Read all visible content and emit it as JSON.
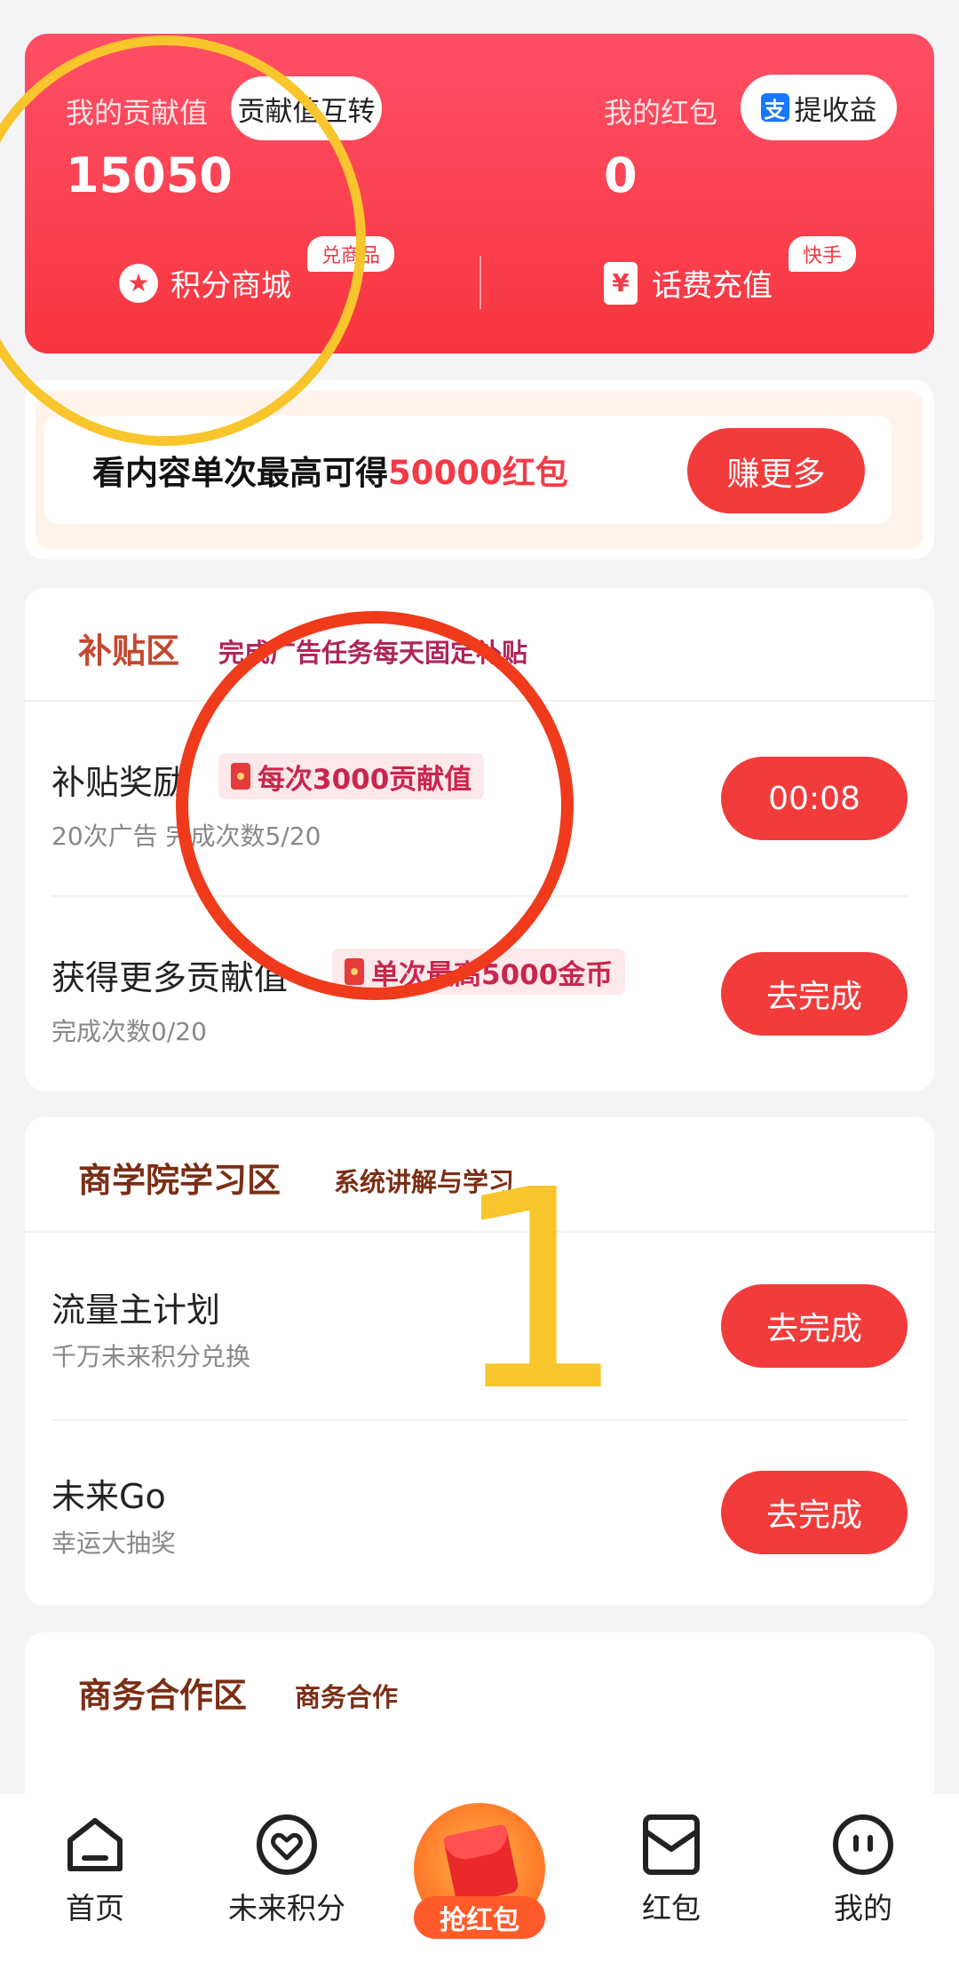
{
  "top_card": {
    "contribution_label": "我的贡献值",
    "contribution_convert_btn": "贡献值互转",
    "contribution_value": "15050",
    "redpacket_label": "我的红包",
    "withdraw_icon": "支",
    "withdraw_btn": "提收益",
    "redpacket_value": "0",
    "mall_label": "积分商城",
    "mall_tag": "兑商品",
    "recharge_label": "话费充值",
    "recharge_tag": "快手"
  },
  "banner": {
    "text_prefix": "看内容单次最高可得",
    "text_highlight": "50000红包",
    "button": "赚更多"
  },
  "subsidy": {
    "title": "补贴区",
    "subtitle": "完成广告任务每天固定补贴",
    "items": [
      {
        "title": "补贴奖励",
        "tag": "每次3000贡献值",
        "sub": "20次广告 完成次数5/20",
        "button": "00:08"
      },
      {
        "title": "获得更多贡献值",
        "tag": "单次最高5000金币",
        "sub": "完成次数0/20",
        "button": "去完成"
      }
    ]
  },
  "academy": {
    "title": "商学院学习区",
    "subtitle": "系统讲解与学习",
    "items": [
      {
        "title": "流量主计划",
        "sub": "千万未来积分兑换",
        "button": "去完成"
      },
      {
        "title": "未来Go",
        "sub": "幸运大抽奖",
        "button": "去完成"
      }
    ]
  },
  "business": {
    "title": "商务合作区",
    "subtitle": "商务合作"
  },
  "annotation": {
    "number": "1"
  },
  "nav": {
    "home": "首页",
    "points": "未来积分",
    "grab": "抢红包",
    "redpacket": "红包",
    "mine": "我的"
  }
}
